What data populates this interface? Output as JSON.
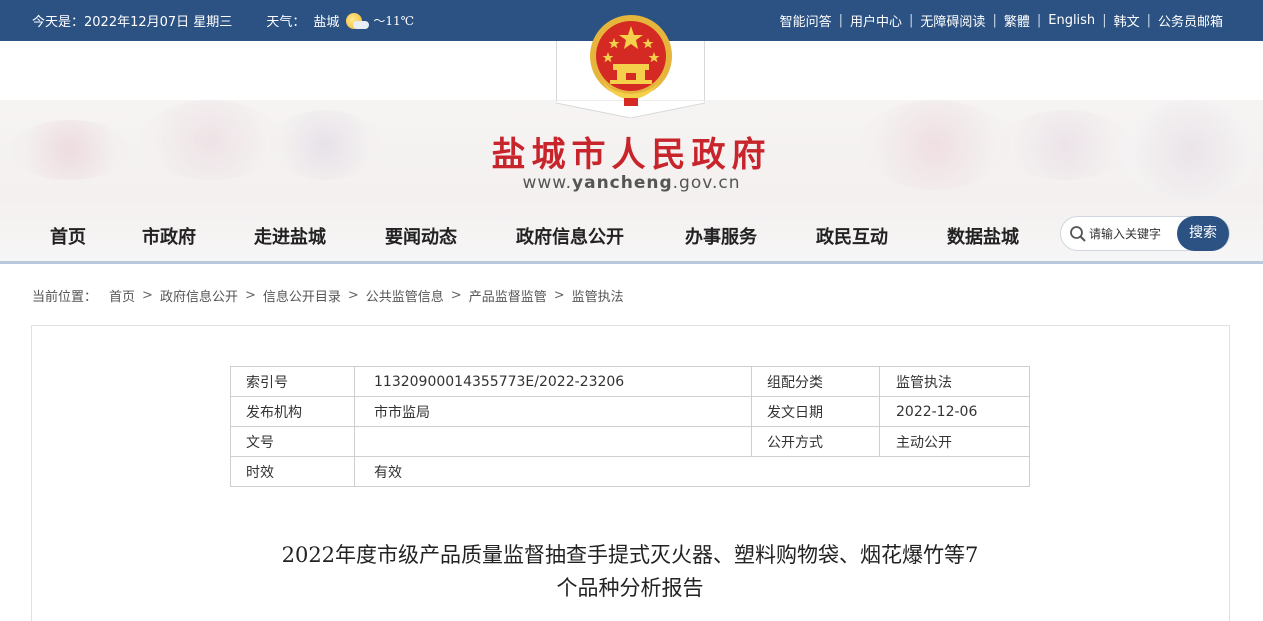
{
  "topbar": {
    "date": "今天是：2022年12月07日 星期三",
    "weather_label": "天气：",
    "city": "盐城",
    "weather_icon": "sun-cloud-icon",
    "temperature": "～11℃",
    "links": [
      "智能问答",
      "用户中心",
      "无障碍阅读",
      "繁體",
      "English",
      "韩文",
      "公务员邮箱"
    ]
  },
  "header": {
    "title": "盐城市人民政府",
    "url_prefix": "www.",
    "url_domain": "yancheng",
    "url_suffix": ".gov.cn"
  },
  "nav": {
    "items": [
      "首页",
      "市政府",
      "走进盐城",
      "要闻动态",
      "政府信息公开",
      "办事服务",
      "政民互动",
      "数据盐城"
    ]
  },
  "search": {
    "placeholder": "请输入关键字",
    "button": "搜索"
  },
  "breadcrumb": {
    "label": "当前位置：",
    "items": [
      "首页",
      "政府信息公开",
      "信息公开目录",
      "公共监管信息",
      "产品监督监管",
      "监管执法"
    ]
  },
  "meta_table": {
    "rows": [
      [
        "索引号",
        "11320900014355773E/2022-23206",
        "组配分类",
        "监管执法"
      ],
      [
        "发布机构",
        "市市监局",
        "发文日期",
        "2022-12-06"
      ],
      [
        "文号",
        "",
        "公开方式",
        "主动公开"
      ],
      [
        "时效",
        "有效"
      ]
    ]
  },
  "article": {
    "title_line1": "2022年度市级产品质量监督抽查手提式灭火器、塑料购物袋、烟花爆竹等7",
    "title_line2": "个品种分析报告"
  },
  "colors": {
    "brand_blue": "#2b5283",
    "title_red": "#c8242b"
  }
}
